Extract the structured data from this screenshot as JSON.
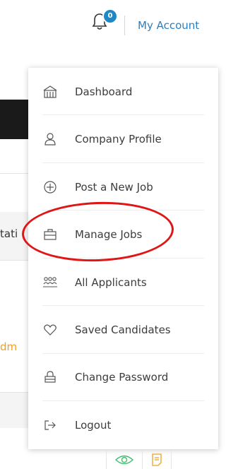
{
  "header": {
    "notification_count": "0",
    "account_label": "My Account"
  },
  "background": {
    "partial_status": "tati",
    "partial_admin": "dm"
  },
  "menu": {
    "items": [
      {
        "label": "Dashboard",
        "icon": "dashboard-icon"
      },
      {
        "label": "Company Profile",
        "icon": "user-icon"
      },
      {
        "label": "Post a New Job",
        "icon": "plus-circle-icon"
      },
      {
        "label": "Manage Jobs",
        "icon": "briefcase-icon"
      },
      {
        "label": "All Applicants",
        "icon": "group-icon"
      },
      {
        "label": "Saved Candidates",
        "icon": "heart-icon"
      },
      {
        "label": "Change Password",
        "icon": "lock-icon"
      },
      {
        "label": "Logout",
        "icon": "logout-icon"
      }
    ]
  },
  "colors": {
    "accent": "#2b7fbf",
    "badge": "#1e88c7",
    "highlight": "#e01515"
  }
}
